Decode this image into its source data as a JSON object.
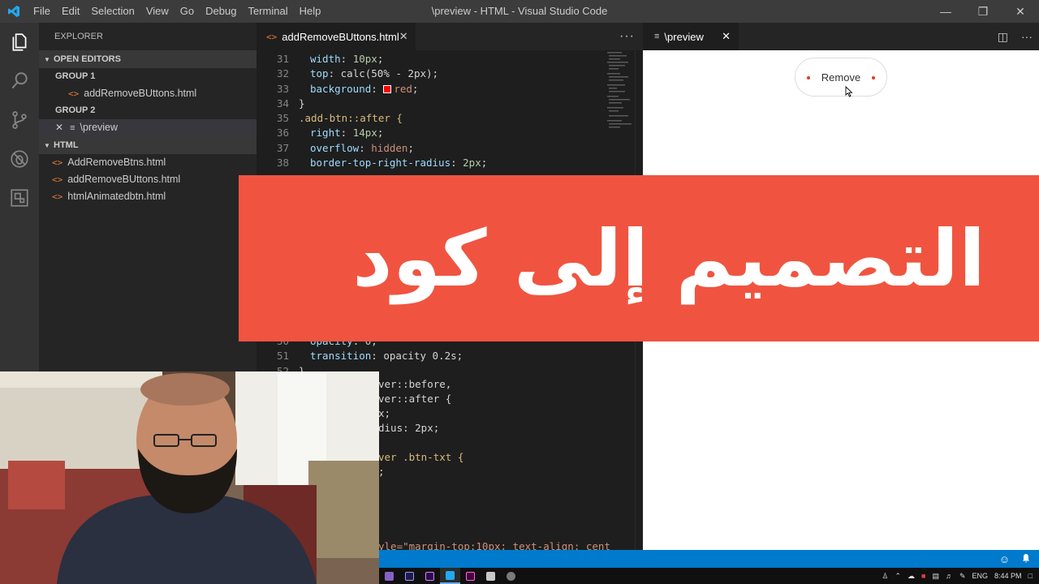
{
  "window": {
    "title": "\\preview - HTML - Visual Studio Code",
    "menu": [
      "File",
      "Edit",
      "Selection",
      "View",
      "Go",
      "Debug",
      "Terminal",
      "Help"
    ]
  },
  "activity_bar": [
    "files-icon",
    "search-icon",
    "source-control-icon",
    "debug-icon",
    "extensions-icon"
  ],
  "sidebar": {
    "title": "EXPLORER",
    "open_editors": {
      "heading": "OPEN EDITORS",
      "group1": {
        "label": "GROUP 1",
        "file": "addRemoveBUttons.html"
      },
      "group2": {
        "label": "GROUP 2",
        "file": "\\preview"
      }
    },
    "folder": {
      "heading": "HTML",
      "files": [
        "AddRemoveBtns.html",
        "addRemoveBUttons.html",
        "htmlAnimatedbtn.html"
      ]
    }
  },
  "editor": {
    "tab_label": "addRemoveBUttons.html",
    "code_lines": [
      {
        "n": "31",
        "prop": "width",
        "val": "10px",
        "kind": "num"
      },
      {
        "n": "32",
        "prop": "top",
        "val": "calc(50% - 2px)",
        "kind": "plain"
      },
      {
        "n": "33",
        "prop": "background",
        "val": "red",
        "kind": "color"
      },
      {
        "n": "34",
        "text": "}"
      },
      {
        "n": "35",
        "selector": ".add-btn::after {"
      },
      {
        "n": "36",
        "prop": "right",
        "val": "14px",
        "kind": "num"
      },
      {
        "n": "37",
        "prop": "overflow",
        "val": "hidden",
        "kind": "str"
      },
      {
        "n": "38",
        "prop": "border-top-right-radius",
        "val": "2px",
        "kind": "num"
      }
    ],
    "code_lines_lower": [
      {
        "n": "50",
        "prop": "opacity",
        "val": "0",
        "kind": "num"
      },
      {
        "n": "51",
        "prop": "transition",
        "val": "opacity 0.2s",
        "kind": "plain"
      },
      {
        "n": "52",
        "text": "}"
      }
    ],
    "code_fragments": [
      "ver::before,",
      "ver::after {",
      "x;",
      "dius: 2px;",
      "ver .btn-txt {",
      ";",
      "yle=\"margin-top:10px; text-align: cent"
    ]
  },
  "preview": {
    "tab_label": "\\preview",
    "button_label": "Remove"
  },
  "banner": {
    "text": "التصميم إلى كود"
  },
  "taskbar": {
    "lang": "ENG",
    "time": "8:44 PM"
  },
  "colors": {
    "accent": "#007acc",
    "banner": "#f05440",
    "dot": "#e03b24"
  }
}
